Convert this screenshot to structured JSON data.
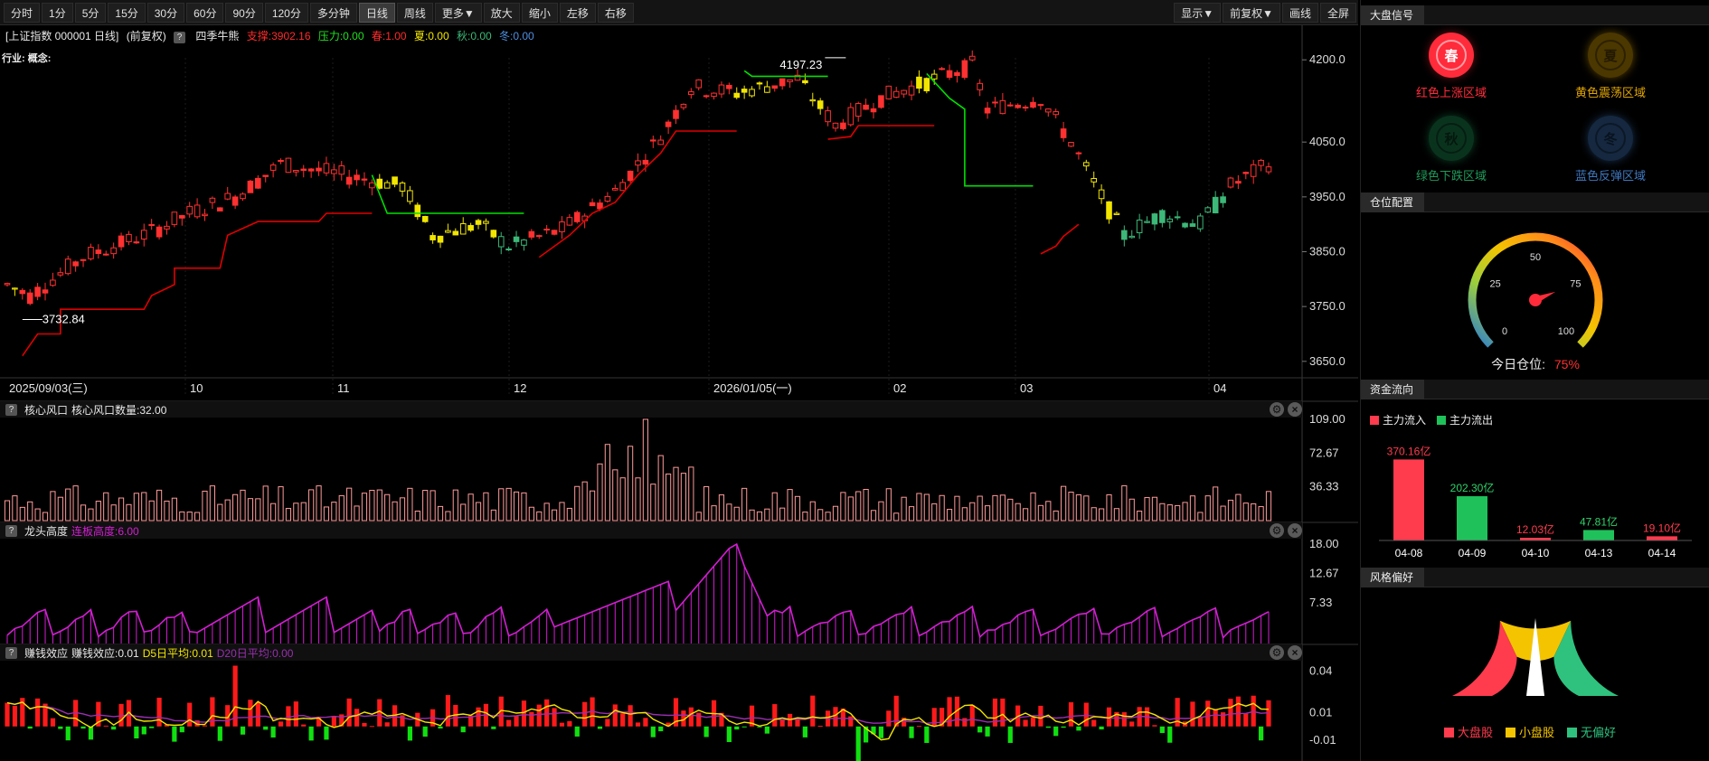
{
  "toolbar": {
    "periods": [
      "分时",
      "1分",
      "5分",
      "15分",
      "30分",
      "60分",
      "90分",
      "120分",
      "多分钟",
      "日线",
      "周线",
      "更多▼",
      "放大",
      "缩小",
      "左移",
      "右移"
    ],
    "active_period": "日线",
    "right_buttons": [
      "显示▼",
      "前复权▼",
      "画线",
      "全屏"
    ]
  },
  "main_chart": {
    "info": {
      "name": "[上证指数 000001 日线]",
      "adjust": "(前复权)",
      "indicator": "四季牛熊",
      "support": "支撑:3902.16",
      "pressure": "压力:0.00",
      "spring": "春:1.00",
      "summer": "夏:0.00",
      "autumn": "秋:0.00",
      "winter": "冬:0.00"
    },
    "industry_label": "行业: 概念:",
    "y_ticks": [
      "4200.0",
      "4050.0",
      "3950.0",
      "3850.0",
      "3750.0",
      "3650.0"
    ],
    "x_labels": [
      "2025/09/03(三)",
      "10",
      "11",
      "12",
      "2026/01/05(一)",
      "02",
      "03",
      "04"
    ],
    "high_label": "4197.23",
    "low_label": "3732.84"
  },
  "indicators": [
    {
      "title": "核心风口",
      "params": [
        {
          "text": "核心风口数量:32.00",
          "color": "#e8e8e8"
        }
      ],
      "y_ticks": [
        "109.00",
        "72.67",
        "36.33"
      ]
    },
    {
      "title": "龙头高度",
      "params": [
        {
          "text": "连板高度:6.00",
          "color": "#d21fd2"
        }
      ],
      "y_ticks": [
        "18.00",
        "12.67",
        "7.33"
      ]
    },
    {
      "title": "赚钱效应",
      "params": [
        {
          "text": "赚钱效应:0.01",
          "color": "#e8e8e8"
        },
        {
          "text": "D5日平均:0.01",
          "color": "#f2e600"
        },
        {
          "text": "D20日平均:0.00",
          "color": "#9a2fb0"
        }
      ],
      "y_ticks": [
        "0.04",
        "0.01",
        "-0.01"
      ]
    }
  ],
  "side": {
    "signal": {
      "title": "大盘信号",
      "seasons": [
        {
          "char": "春",
          "label": "红色上涨区域",
          "color": "#ff2b3b",
          "active": true
        },
        {
          "char": "夏",
          "label": "黄色震荡区域",
          "color": "#e0a400",
          "active": false
        },
        {
          "char": "秋",
          "label": "绿色下跌区域",
          "color": "#1f9a5a",
          "active": false
        },
        {
          "char": "冬",
          "label": "蓝色反弹区域",
          "color": "#3f78c0",
          "active": false
        }
      ]
    },
    "position": {
      "title": "仓位配置",
      "ticks": [
        "0",
        "25",
        "50",
        "75",
        "100"
      ],
      "label": "今日仓位:",
      "value": "75%",
      "value_number": 75
    },
    "fund_flow": {
      "title": "资金流向",
      "legend_in": "主力流入",
      "legend_out": "主力流出",
      "bars": [
        {
          "date": "04-08",
          "label": "370.16亿",
          "value": 370.16,
          "dir": "in"
        },
        {
          "date": "04-09",
          "label": "202.30亿",
          "value": 202.3,
          "dir": "out"
        },
        {
          "date": "04-10",
          "label": "12.03亿",
          "value": 12.03,
          "dir": "in"
        },
        {
          "date": "04-13",
          "label": "47.81亿",
          "value": 47.81,
          "dir": "out"
        },
        {
          "date": "04-14",
          "label": "19.10亿",
          "value": 19.1,
          "dir": "in"
        }
      ]
    },
    "style": {
      "title": "风格偏好",
      "legend": [
        {
          "label": "大盘股",
          "color": "#ff3b4e"
        },
        {
          "label": "小盘股",
          "color": "#f4c400"
        },
        {
          "label": "无偏好",
          "color": "#2ec27e"
        }
      ]
    }
  },
  "colors": {
    "up": "#ff3030",
    "down_green": "#3cb878",
    "neutral_yellow": "#f2e600",
    "support": "#e00000",
    "pressure": "#00e000",
    "ma_magenta": "#d21fd2"
  }
}
